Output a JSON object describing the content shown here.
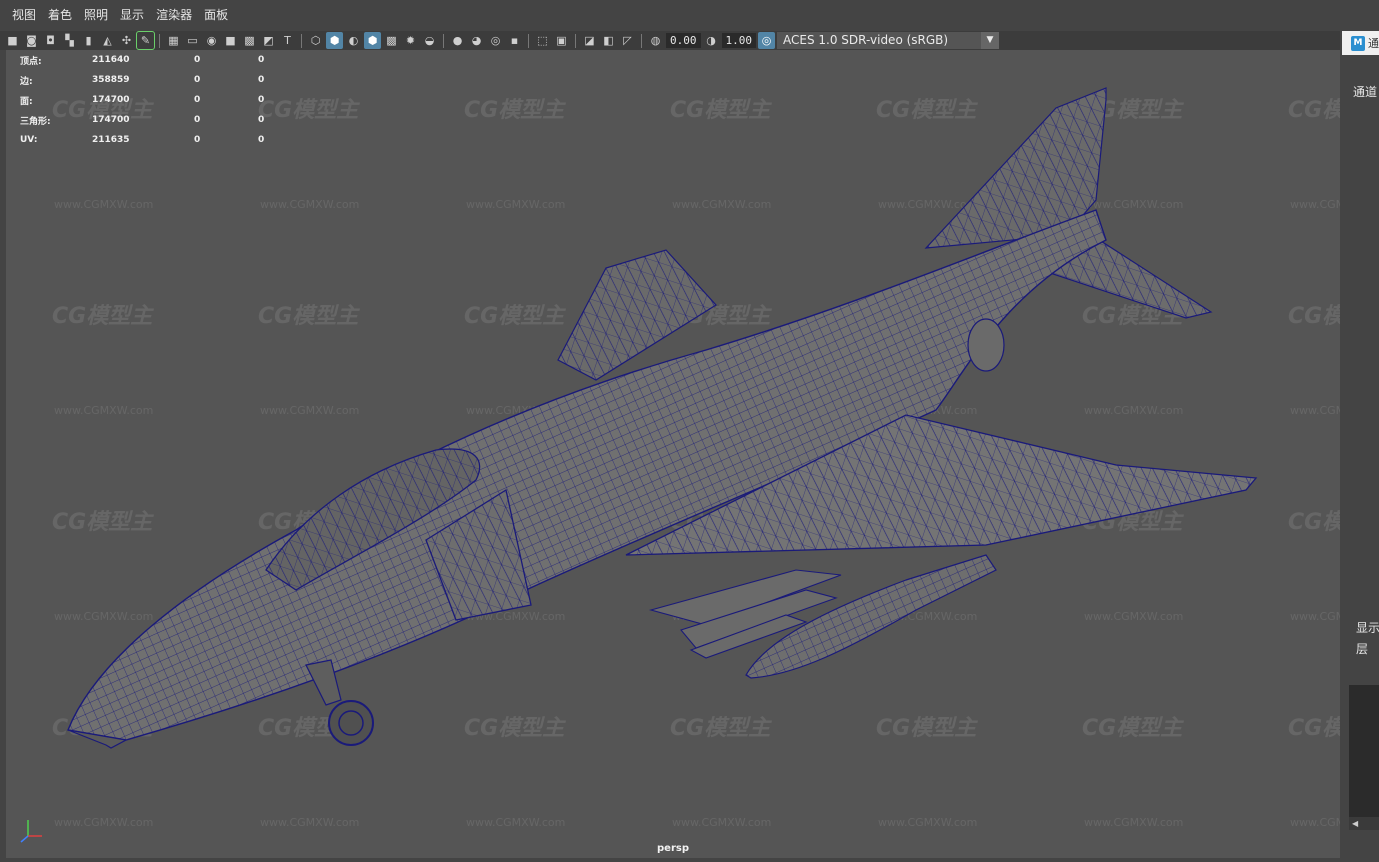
{
  "menu": [
    "视图",
    "着色",
    "照明",
    "显示",
    "渲染器",
    "面板"
  ],
  "toolbar": {
    "exposure": "0.00",
    "gamma": "1.00",
    "color_space": "ACES 1.0 SDR-video (sRGB)"
  },
  "hud": [
    {
      "label": "顶点:",
      "value": "211640",
      "c1": "0",
      "c2": "0"
    },
    {
      "label": "边:",
      "value": "358859",
      "c1": "0",
      "c2": "0"
    },
    {
      "label": "面:",
      "value": "174700",
      "c1": "0",
      "c2": "0"
    },
    {
      "label": "三角形:",
      "value": "174700",
      "c1": "0",
      "c2": "0"
    },
    {
      "label": "UV:",
      "value": "211635",
      "c1": "0",
      "c2": "0"
    }
  ],
  "camera": "persp",
  "watermark": {
    "logo": "CG模型主",
    "url": "www.CGMXW.com"
  },
  "right_panel": {
    "tab": "通",
    "channel": "通道",
    "display": "显示",
    "layer": "层"
  },
  "colors": {
    "viewport": "#555555",
    "wireframe": "#1a1a7a",
    "accent": "#5285a6"
  }
}
